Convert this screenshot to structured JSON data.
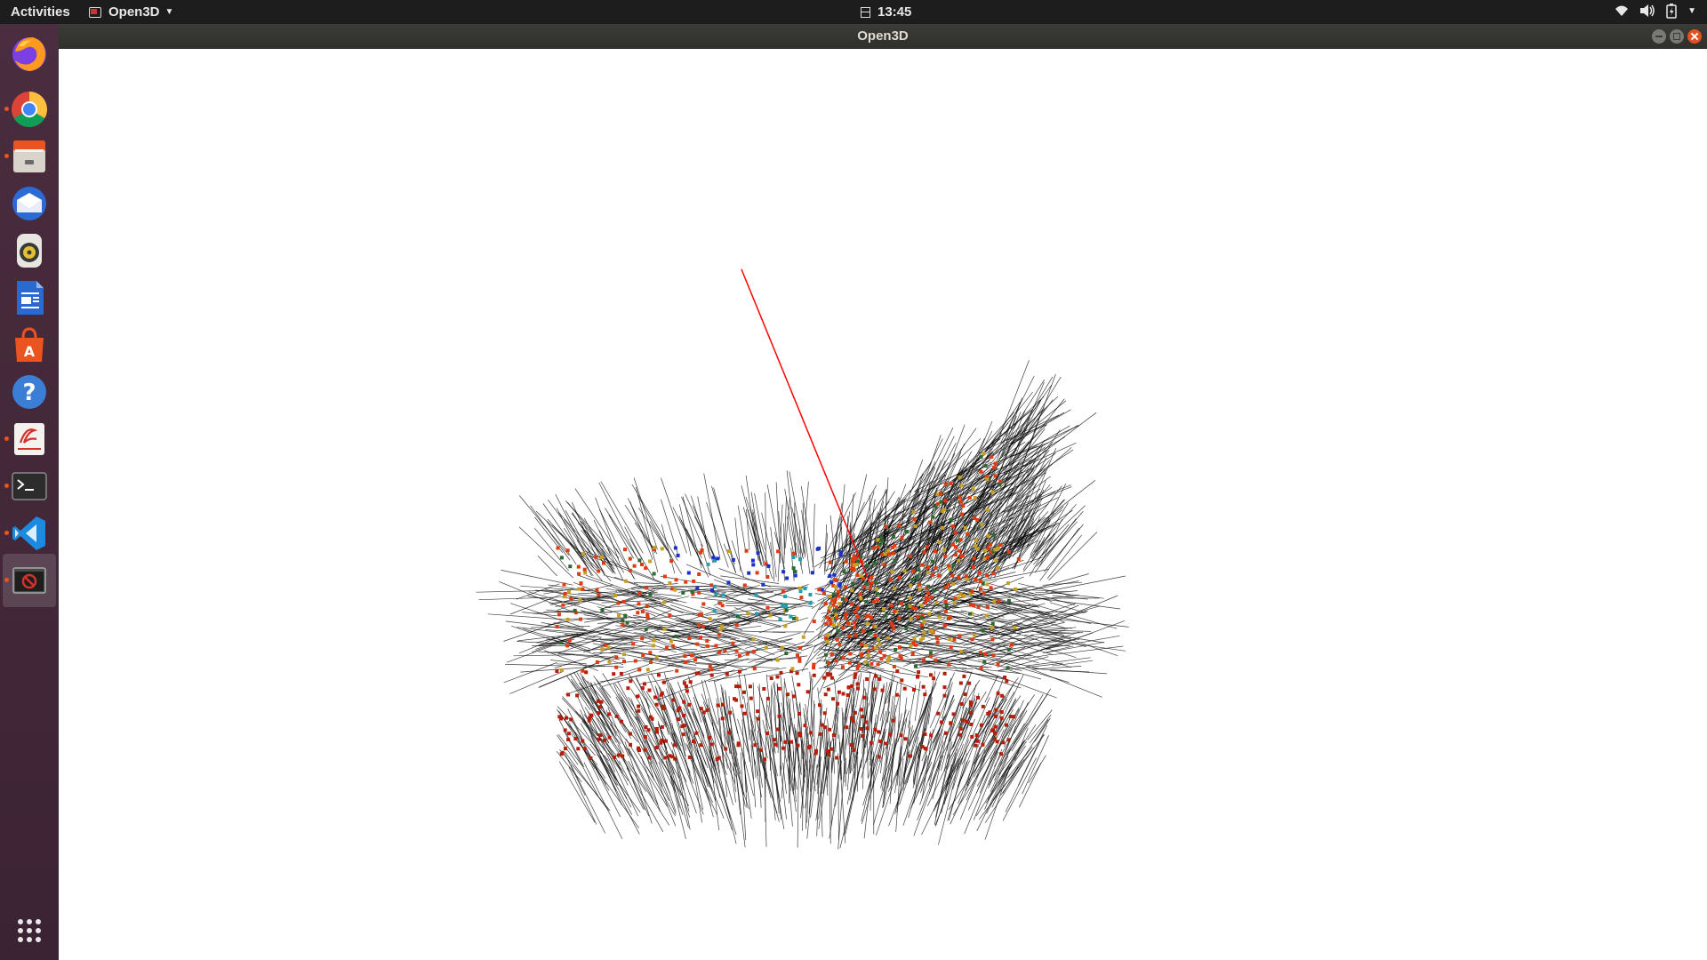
{
  "topbar": {
    "activities_label": "Activities",
    "app_menu_label": "Open3D",
    "clock": "13:45",
    "status_icons": [
      "wifi-icon",
      "volume-icon",
      "battery-icon",
      "system-menu-chevron-icon"
    ]
  },
  "window": {
    "title": "Open3D",
    "controls": [
      "minimize",
      "maximize",
      "close"
    ]
  },
  "dock": {
    "items": [
      {
        "name": "firefox",
        "icon": "firefox-icon",
        "running": false
      },
      {
        "name": "chrome",
        "icon": "chrome-icon",
        "running": true
      },
      {
        "name": "files",
        "icon": "files-icon",
        "running": true
      },
      {
        "name": "thunderbird",
        "icon": "thunderbird-icon",
        "running": false
      },
      {
        "name": "rhythmbox",
        "icon": "rhythmbox-icon",
        "running": false
      },
      {
        "name": "libreoffice-writer",
        "icon": "writer-icon",
        "running": false
      },
      {
        "name": "ubuntu-software",
        "icon": "software-icon",
        "running": false
      },
      {
        "name": "help",
        "icon": "help-icon",
        "running": false
      },
      {
        "name": "document-viewer",
        "icon": "document-viewer-icon",
        "running": true
      },
      {
        "name": "terminal",
        "icon": "terminal-icon",
        "running": true
      },
      {
        "name": "vscode",
        "icon": "vscode-icon",
        "running": true
      },
      {
        "name": "open3d",
        "icon": "open3d-window-icon",
        "running": true,
        "active": true
      }
    ],
    "show_apps_icon": "grid-icon"
  },
  "viewer": {
    "content": "point cloud of a chair with surface normals rendered as line segments",
    "background_color": "#ffffff",
    "normal_line_color": "#000000",
    "axis_line_color": "#ff0000",
    "point_colors": [
      "#b81d0a",
      "#e23a10",
      "#1a2fd0",
      "#1aa0b0",
      "#c8a020",
      "#2a6a30"
    ]
  }
}
